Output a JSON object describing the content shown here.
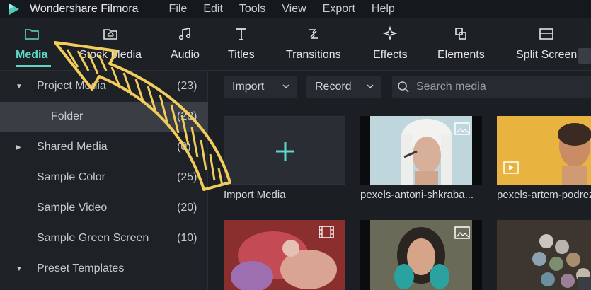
{
  "app": {
    "title": "Wondershare Filmora",
    "menus": [
      "File",
      "Edit",
      "Tools",
      "View",
      "Export",
      "Help"
    ]
  },
  "toolbar": {
    "items": [
      {
        "label": "Media",
        "icon": "folder-icon",
        "active": true
      },
      {
        "label": "Stock Media",
        "icon": "cloud-folder-icon",
        "active": false
      },
      {
        "label": "Audio",
        "icon": "music-note-icon",
        "active": false
      },
      {
        "label": "Titles",
        "icon": "text-t-icon",
        "active": false
      },
      {
        "label": "Transitions",
        "icon": "transition-icon",
        "active": false
      },
      {
        "label": "Effects",
        "icon": "sparkle-icon",
        "active": false
      },
      {
        "label": "Elements",
        "icon": "elements-icon",
        "active": false
      },
      {
        "label": "Split Screen",
        "icon": "split-screen-icon",
        "active": false
      }
    ]
  },
  "sidebar": {
    "items": [
      {
        "label": "Project Media",
        "count": "(23)",
        "expanded": true
      },
      {
        "label": "Folder",
        "count": "(23)",
        "selected": true
      },
      {
        "label": "Shared Media",
        "count": "(0)",
        "expanded": false
      },
      {
        "label": "Sample Color",
        "count": "(25)"
      },
      {
        "label": "Sample Video",
        "count": "(20)"
      },
      {
        "label": "Sample Green Screen",
        "count": "(10)"
      },
      {
        "label": "Preset Templates",
        "count": "",
        "expanded": true
      }
    ]
  },
  "media_bar": {
    "import_label": "Import",
    "record_label": "Record",
    "search_placeholder": "Search media"
  },
  "media": {
    "tiles": [
      {
        "label": "Import Media",
        "kind": "import"
      },
      {
        "label": "pexels-antoni-shkraba...",
        "kind": "image"
      },
      {
        "label": "pexels-artem-podrez",
        "kind": "video"
      },
      {
        "label": "",
        "kind": "video"
      },
      {
        "label": "",
        "kind": "image"
      },
      {
        "label": "",
        "kind": "image"
      }
    ]
  },
  "colors": {
    "accent": "#5fd7c8",
    "annotation": "#f2cd5c"
  }
}
